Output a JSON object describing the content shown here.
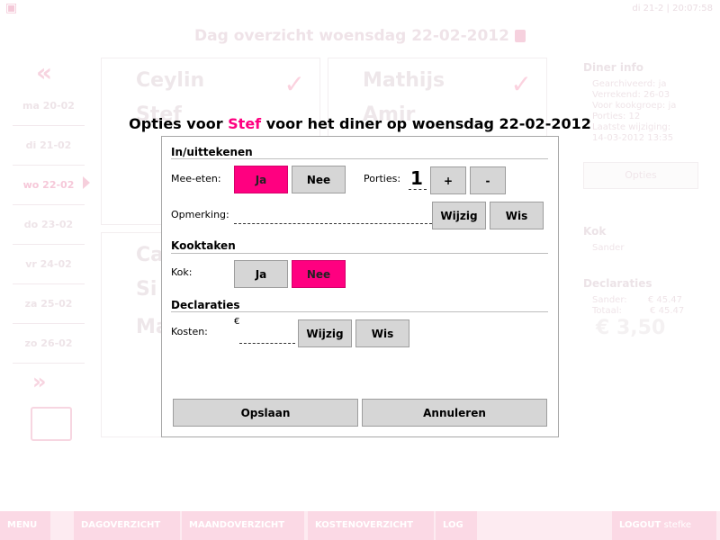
{
  "header": {
    "datetime": "di 21-2 | 20:07:58",
    "day_title": "Dag overzicht woensdag 22-02-2012"
  },
  "days": [
    {
      "label": "ma 20-02"
    },
    {
      "label": "di 21-02"
    },
    {
      "label": "wo 22-02"
    },
    {
      "label": "do 23-02"
    },
    {
      "label": "vr 24-02"
    },
    {
      "label": "za 25-02"
    },
    {
      "label": "zo 26-02"
    }
  ],
  "cards": {
    "c1_name": "Ceylin",
    "c1_name2": "Stef",
    "c2_name": "Mathijs",
    "c2_name2": "Amir",
    "c3_name": "Ca",
    "c3_name2": "Si",
    "c3_name3": "Ma"
  },
  "right_panel": {
    "diner_title": "Diner info",
    "diner_lines": [
      "Gearchiveerd: ja",
      "Verrekend: 26-03",
      "Voor kookgroep: ja",
      "Porties: 12",
      "Laatste wijziging:",
      "14-03-2012 13:35"
    ],
    "opties_label": "Opties",
    "kok_title": "Kok",
    "kok_name": "Sander",
    "declaraties_title": "Declaraties",
    "decl_name": "Sander:",
    "decl_amount": "€ 45.47",
    "totaal_label": "Totaal:",
    "totaal_amount": "€ 45.47",
    "big_price": "€ 3,50"
  },
  "bottombar": {
    "menu": "MENU",
    "dagoverzicht": "DAGOVERZICHT",
    "maandoverzicht": "MAANDOVERZICHT",
    "kostenoverzicht": "KOSTENOVERZICHT",
    "log": "LOG",
    "logout": "LOGOUT",
    "user": "stefke"
  },
  "dialog": {
    "title_prefix": "Opties voor ",
    "title_name": "Stef",
    "title_suffix": " voor het diner op woensdag 22-02-2012",
    "section_inuit": "In/uittekenen",
    "mee_eten_label": "Mee-eten:",
    "ja_label": "Ja",
    "nee_label": "Nee",
    "porties_label": "Porties:",
    "porties_value": "1",
    "plus_label": "+",
    "minus_label": "-",
    "opmerking_label": "Opmerking:",
    "wijzig_label": "Wijzig",
    "wis_label": "Wis",
    "section_kooktaken": "Kooktaken",
    "kok_label": "Kok:",
    "section_declaraties": "Declaraties",
    "kosten_label": "Kosten:",
    "euro_symbol": "€",
    "opslaan_label": "Opslaan",
    "annuleren_label": "Annuleren",
    "mee_eten_selected": "Ja",
    "kok_selected": "Nee"
  },
  "colors": {
    "accent": "#ff0080",
    "button_gray": "#d6d6d6"
  }
}
